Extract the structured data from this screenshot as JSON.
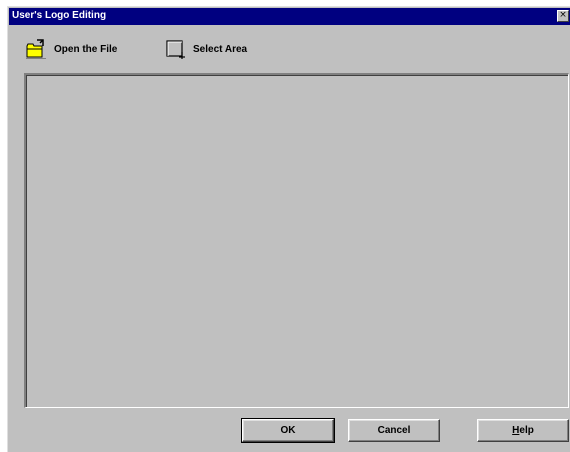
{
  "window": {
    "title": "User's Logo Editing",
    "close_glyph": "×"
  },
  "toolbar": {
    "open_label": "Open the File",
    "open_icon": "open-file-folder-icon",
    "select_label": "Select Area",
    "select_icon": "select-area-icon"
  },
  "buttons": {
    "ok_label": "OK",
    "cancel_label": "Cancel",
    "help_mnemonic": "H",
    "help_rest": "elp"
  },
  "colors": {
    "titlebar": "#000080",
    "face": "#c0c0c0",
    "folder": "#ffff00"
  }
}
